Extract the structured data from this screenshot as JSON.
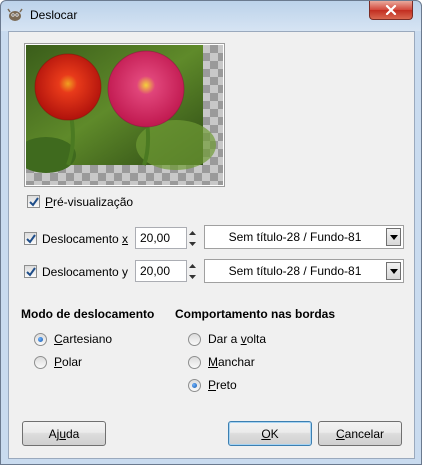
{
  "window": {
    "title": "Deslocar"
  },
  "preview": {
    "label_pre": "",
    "label_u": "P",
    "label_post": "ré-visualização",
    "checked": true
  },
  "offset_x": {
    "label_pre": "Deslocamento ",
    "label_u": "x",
    "label_post": "",
    "checked": true,
    "value": "20,00",
    "drawable": "Sem título-28 / Fundo-81"
  },
  "offset_y": {
    "label": "Deslocamento y",
    "checked": true,
    "value": "20,00",
    "drawable": "Sem título-28 / Fundo-81"
  },
  "shift_mode": {
    "title": "Modo de deslocamento",
    "options": [
      {
        "label_u": "C",
        "label_post": "artesiano",
        "selected": true
      },
      {
        "label_u": "P",
        "label_post": "olar",
        "selected": false
      }
    ]
  },
  "edge_behavior": {
    "title": "Comportamento nas bordas",
    "options": [
      {
        "label_pre": "Dar a ",
        "label_u": "v",
        "label_post": "olta",
        "selected": false
      },
      {
        "label_pre": "",
        "label_u": "M",
        "label_post": "anchar",
        "selected": false
      },
      {
        "label_pre": "",
        "label_u": "P",
        "label_post": "reto",
        "selected": true
      }
    ]
  },
  "buttons": {
    "help": {
      "label_pre": "Aj",
      "label_u": "u",
      "label_post": "da"
    },
    "ok": {
      "label_pre": "",
      "label_u": "O",
      "label_post": "K"
    },
    "cancel": {
      "label_pre": "",
      "label_u": "C",
      "label_post": "ancelar"
    }
  }
}
